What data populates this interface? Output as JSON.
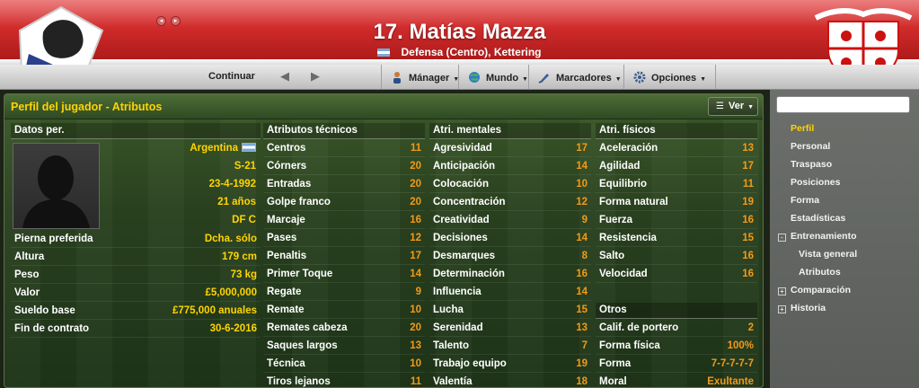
{
  "header": {
    "player_title": "17. Matías Mazza",
    "player_subtitle": "Defensa (Centro), Kettering"
  },
  "toolbar": {
    "continue_label": "Continuar",
    "menus": [
      "Mánager",
      "Mundo",
      "Marcadores",
      "Opciones"
    ]
  },
  "panel": {
    "title": "Perfil del jugador - Atributos",
    "ver_label": "Ver"
  },
  "personal": {
    "heading": "Datos per.",
    "top_values": [
      "Argentina",
      "S-21",
      "23-4-1992",
      "21 años",
      "DF C"
    ],
    "rows": [
      {
        "label": "Pierna preferida",
        "value": "Dcha. sólo"
      },
      {
        "label": "Altura",
        "value": "179 cm"
      },
      {
        "label": "Peso",
        "value": "73 kg"
      },
      {
        "label": "Valor",
        "value": "£5,000,000"
      },
      {
        "label": "Sueldo base",
        "value": "£775,000 anuales"
      },
      {
        "label": "Fin de contrato",
        "value": "30-6-2016"
      }
    ]
  },
  "technical": {
    "heading": "Atributos técnicos",
    "rows": [
      {
        "label": "Centros",
        "value": "11"
      },
      {
        "label": "Córners",
        "value": "20"
      },
      {
        "label": "Entradas",
        "value": "20"
      },
      {
        "label": "Golpe franco",
        "value": "20"
      },
      {
        "label": "Marcaje",
        "value": "16"
      },
      {
        "label": "Pases",
        "value": "12"
      },
      {
        "label": "Penaltis",
        "value": "17"
      },
      {
        "label": "Primer Toque",
        "value": "14"
      },
      {
        "label": "Regate",
        "value": "9"
      },
      {
        "label": "Remate",
        "value": "10"
      },
      {
        "label": "Remates cabeza",
        "value": "20"
      },
      {
        "label": "Saques largos",
        "value": "13"
      },
      {
        "label": "Técnica",
        "value": "10"
      },
      {
        "label": "Tiros lejanos",
        "value": "11"
      }
    ]
  },
  "mental": {
    "heading": "Atri. mentales",
    "rows": [
      {
        "label": "Agresividad",
        "value": "17"
      },
      {
        "label": "Anticipación",
        "value": "14"
      },
      {
        "label": "Colocación",
        "value": "10"
      },
      {
        "label": "Concentración",
        "value": "12"
      },
      {
        "label": "Creatividad",
        "value": "9"
      },
      {
        "label": "Decisiones",
        "value": "14"
      },
      {
        "label": "Desmarques",
        "value": "8"
      },
      {
        "label": "Determinación",
        "value": "16"
      },
      {
        "label": "Influencia",
        "value": "14"
      },
      {
        "label": "Lucha",
        "value": "15"
      },
      {
        "label": "Serenidad",
        "value": "13"
      },
      {
        "label": "Talento",
        "value": "7"
      },
      {
        "label": "Trabajo equipo",
        "value": "19"
      },
      {
        "label": "Valentía",
        "value": "18"
      }
    ]
  },
  "physical": {
    "heading": "Atri. físicos",
    "rows": [
      {
        "label": "Aceleración",
        "value": "13"
      },
      {
        "label": "Agilidad",
        "value": "17"
      },
      {
        "label": "Equilibrio",
        "value": "11"
      },
      {
        "label": "Forma natural",
        "value": "19"
      },
      {
        "label": "Fuerza",
        "value": "16"
      },
      {
        "label": "Resistencia",
        "value": "15"
      },
      {
        "label": "Salto",
        "value": "16"
      },
      {
        "label": "Velocidad",
        "value": "16"
      }
    ]
  },
  "others": {
    "heading": "Otros",
    "rows": [
      {
        "label": "Calif. de portero",
        "value": "2"
      },
      {
        "label": "Forma física",
        "value": "100%"
      },
      {
        "label": "Forma",
        "value": "7-7-7-7-7"
      },
      {
        "label": "Moral",
        "value": "Exultante"
      }
    ]
  },
  "sidebar": {
    "items": [
      "Perfil",
      "Personal",
      "Traspaso",
      "Posiciones",
      "Forma",
      "Estadísticas",
      "Entrenamiento",
      "Vista general",
      "Atributos",
      "Comparación",
      "Historia"
    ],
    "expanders": [
      "-",
      "+",
      "+"
    ]
  }
}
